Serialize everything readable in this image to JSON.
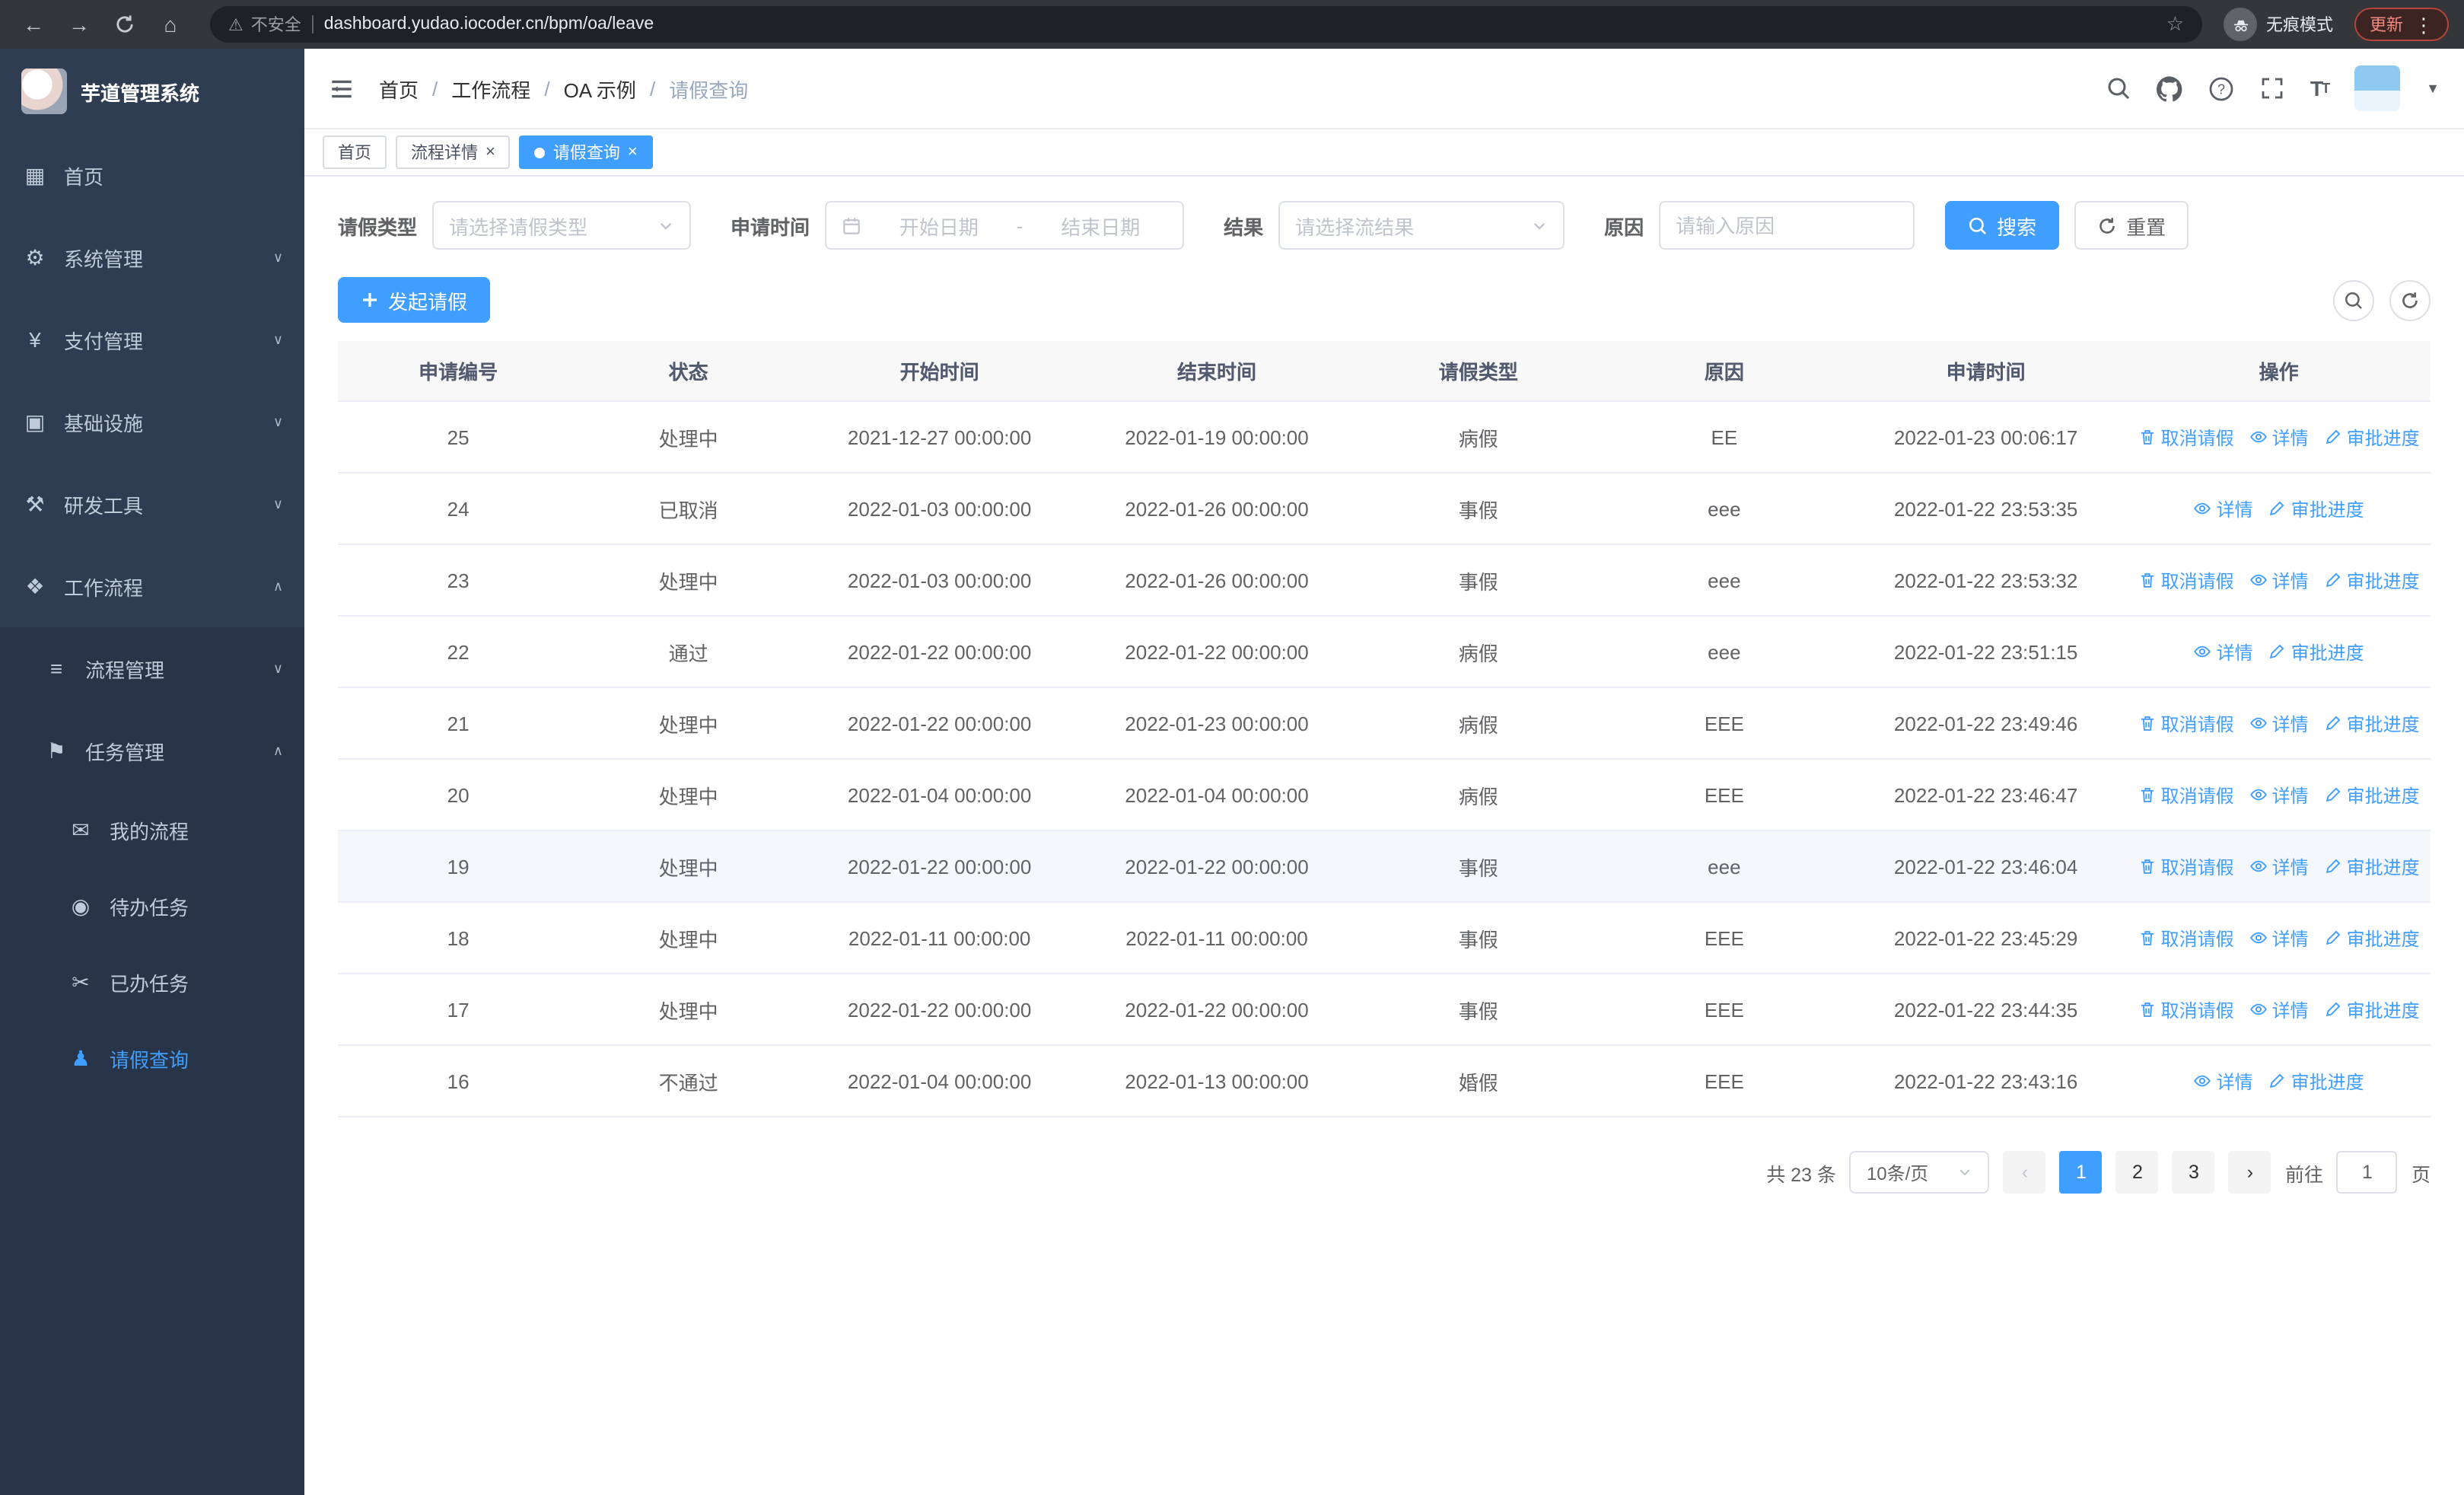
{
  "colors": {
    "primary": "#409EFF",
    "sidebar_bg": "#2F3D52",
    "sidebar_submenu_bg": "#283548"
  },
  "browser": {
    "security_label": "不安全",
    "url": "dashboard.yudao.iocoder.cn/bpm/oa/leave",
    "incognito_label": "无痕模式",
    "update_label": "更新"
  },
  "sidebar": {
    "app_title": "芋道管理系统",
    "items": [
      {
        "key": "home",
        "label": "首页",
        "icon": "dashboard-icon",
        "level": 1
      },
      {
        "key": "system",
        "label": "系统管理",
        "icon": "gear-icon",
        "level": 1,
        "chevron": "down"
      },
      {
        "key": "payment",
        "label": "支付管理",
        "icon": "yen-icon",
        "level": 1,
        "chevron": "down"
      },
      {
        "key": "infra",
        "label": "基础设施",
        "icon": "infra-icon",
        "level": 1,
        "chevron": "down"
      },
      {
        "key": "dev-tools",
        "label": "研发工具",
        "icon": "tools-icon",
        "level": 1,
        "chevron": "down"
      },
      {
        "key": "workflow",
        "label": "工作流程",
        "icon": "workflow-icon",
        "level": 1,
        "chevron": "up"
      },
      {
        "key": "process-mgmt",
        "label": "流程管理",
        "icon": "process-icon",
        "level": 2,
        "chevron": "down"
      },
      {
        "key": "task-mgmt",
        "label": "任务管理",
        "icon": "task-icon",
        "level": 2,
        "chevron": "up"
      },
      {
        "key": "my-process",
        "label": "我的流程",
        "icon": "my-process-icon",
        "level": 3
      },
      {
        "key": "todo-task",
        "label": "待办任务",
        "icon": "todo-icon",
        "level": 3
      },
      {
        "key": "done-task",
        "label": "已办任务",
        "icon": "done-icon",
        "level": 3
      },
      {
        "key": "leave-query",
        "label": "请假查询",
        "icon": "person-icon",
        "level": 3,
        "active": true
      }
    ]
  },
  "header": {
    "breadcrumb": [
      "首页",
      "工作流程",
      "OA 示例",
      "请假查询"
    ]
  },
  "tabs": [
    {
      "label": "首页",
      "closable": false,
      "active": false
    },
    {
      "label": "流程详情",
      "closable": true,
      "active": false
    },
    {
      "label": "请假查询",
      "closable": true,
      "active": true
    }
  ],
  "filters": {
    "leave_type_label": "请假类型",
    "leave_type_placeholder": "请选择请假类型",
    "apply_time_label": "申请时间",
    "start_date_placeholder": "开始日期",
    "range_separator": "-",
    "end_date_placeholder": "结束日期",
    "result_label": "结果",
    "result_placeholder": "请选择流结果",
    "reason_label": "原因",
    "reason_placeholder": "请输入原因",
    "search_label": "搜索",
    "reset_label": "重置"
  },
  "toolbar": {
    "create_label": "发起请假"
  },
  "table": {
    "columns": [
      "申请编号",
      "状态",
      "开始时间",
      "结束时间",
      "请假类型",
      "原因",
      "申请时间",
      "操作"
    ],
    "rows": [
      {
        "id": "25",
        "status": "处理中",
        "start": "2021-12-27 00:00:00",
        "end": "2022-01-19 00:00:00",
        "type": "病假",
        "reason": "EE",
        "applied": "2022-01-23 00:06:17",
        "actions": [
          {
            "name": "cancel",
            "label": "取消请假",
            "icon": "trash-icon"
          },
          {
            "name": "detail",
            "label": "详情",
            "icon": "eye-icon"
          },
          {
            "name": "progress",
            "label": "审批进度",
            "icon": "edit-icon"
          }
        ]
      },
      {
        "id": "24",
        "status": "已取消",
        "start": "2022-01-03 00:00:00",
        "end": "2022-01-26 00:00:00",
        "type": "事假",
        "reason": "eee",
        "applied": "2022-01-22 23:53:35",
        "actions": [
          {
            "name": "detail",
            "label": "详情",
            "icon": "eye-icon"
          },
          {
            "name": "progress",
            "label": "审批进度",
            "icon": "edit-icon"
          }
        ]
      },
      {
        "id": "23",
        "status": "处理中",
        "start": "2022-01-03 00:00:00",
        "end": "2022-01-26 00:00:00",
        "type": "事假",
        "reason": "eee",
        "applied": "2022-01-22 23:53:32",
        "actions": [
          {
            "name": "cancel",
            "label": "取消请假",
            "icon": "trash-icon"
          },
          {
            "name": "detail",
            "label": "详情",
            "icon": "eye-icon"
          },
          {
            "name": "progress",
            "label": "审批进度",
            "icon": "edit-icon"
          }
        ]
      },
      {
        "id": "22",
        "status": "通过",
        "start": "2022-01-22 00:00:00",
        "end": "2022-01-22 00:00:00",
        "type": "病假",
        "reason": "eee",
        "applied": "2022-01-22 23:51:15",
        "actions": [
          {
            "name": "detail",
            "label": "详情",
            "icon": "eye-icon"
          },
          {
            "name": "progress",
            "label": "审批进度",
            "icon": "edit-icon"
          }
        ]
      },
      {
        "id": "21",
        "status": "处理中",
        "start": "2022-01-22 00:00:00",
        "end": "2022-01-23 00:00:00",
        "type": "病假",
        "reason": "EEE",
        "applied": "2022-01-22 23:49:46",
        "actions": [
          {
            "name": "cancel",
            "label": "取消请假",
            "icon": "trash-icon"
          },
          {
            "name": "detail",
            "label": "详情",
            "icon": "eye-icon"
          },
          {
            "name": "progress",
            "label": "审批进度",
            "icon": "edit-icon"
          }
        ]
      },
      {
        "id": "20",
        "status": "处理中",
        "start": "2022-01-04 00:00:00",
        "end": "2022-01-04 00:00:00",
        "type": "病假",
        "reason": "EEE",
        "applied": "2022-01-22 23:46:47",
        "actions": [
          {
            "name": "cancel",
            "label": "取消请假",
            "icon": "trash-icon"
          },
          {
            "name": "detail",
            "label": "详情",
            "icon": "eye-icon"
          },
          {
            "name": "progress",
            "label": "审批进度",
            "icon": "edit-icon"
          }
        ]
      },
      {
        "id": "19",
        "status": "处理中",
        "start": "2022-01-22 00:00:00",
        "end": "2022-01-22 00:00:00",
        "type": "事假",
        "reason": "eee",
        "applied": "2022-01-22 23:46:04",
        "highlight": true,
        "actions": [
          {
            "name": "cancel",
            "label": "取消请假",
            "icon": "trash-icon"
          },
          {
            "name": "detail",
            "label": "详情",
            "icon": "eye-icon"
          },
          {
            "name": "progress",
            "label": "审批进度",
            "icon": "edit-icon"
          }
        ]
      },
      {
        "id": "18",
        "status": "处理中",
        "start": "2022-01-11 00:00:00",
        "end": "2022-01-11 00:00:00",
        "type": "事假",
        "reason": "EEE",
        "applied": "2022-01-22 23:45:29",
        "actions": [
          {
            "name": "cancel",
            "label": "取消请假",
            "icon": "trash-icon"
          },
          {
            "name": "detail",
            "label": "详情",
            "icon": "eye-icon"
          },
          {
            "name": "progress",
            "label": "审批进度",
            "icon": "edit-icon"
          }
        ]
      },
      {
        "id": "17",
        "status": "处理中",
        "start": "2022-01-22 00:00:00",
        "end": "2022-01-22 00:00:00",
        "type": "事假",
        "reason": "EEE",
        "applied": "2022-01-22 23:44:35",
        "actions": [
          {
            "name": "cancel",
            "label": "取消请假",
            "icon": "trash-icon"
          },
          {
            "name": "detail",
            "label": "详情",
            "icon": "eye-icon"
          },
          {
            "name": "progress",
            "label": "审批进度",
            "icon": "edit-icon"
          }
        ]
      },
      {
        "id": "16",
        "status": "不通过",
        "start": "2022-01-04 00:00:00",
        "end": "2022-01-13 00:00:00",
        "type": "婚假",
        "reason": "EEE",
        "applied": "2022-01-22 23:43:16",
        "actions": [
          {
            "name": "detail",
            "label": "详情",
            "icon": "eye-icon"
          },
          {
            "name": "progress",
            "label": "审批进度",
            "icon": "edit-icon"
          }
        ]
      }
    ]
  },
  "pagination": {
    "total_label": "共 23 条",
    "page_size": "10条/页",
    "pages": [
      "1",
      "2",
      "3"
    ],
    "current": "1",
    "goto_label": "前往",
    "goto_value": "1",
    "page_label": "页"
  }
}
